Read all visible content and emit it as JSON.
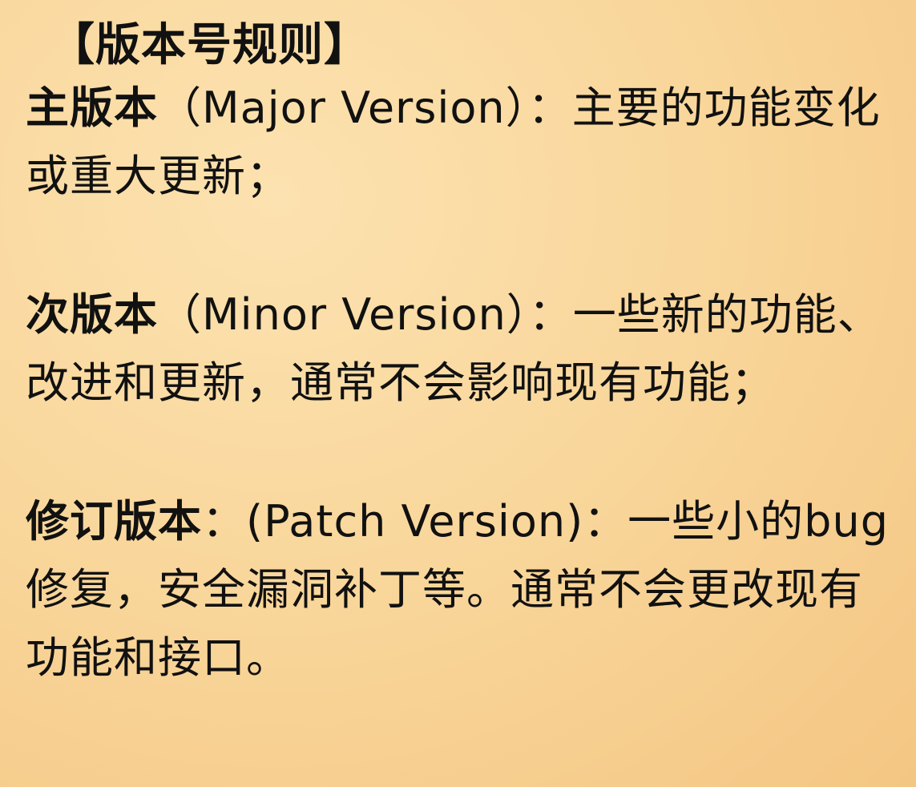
{
  "slide": {
    "title": "【版本号规则】",
    "sections": [
      {
        "heading": "主版本",
        "body": "（Major Version）：主要的功能变化或重大更新；"
      },
      {
        "heading": "次版本",
        "body": "（Minor Version）：一些新的功能、改进和更新，通常不会影响现有功能；"
      },
      {
        "heading": "修订版本",
        "body": "：(Patch Version)：一些小的bug修复，安全漏洞补丁等。通常不会更改现有功能和接口。"
      }
    ]
  }
}
